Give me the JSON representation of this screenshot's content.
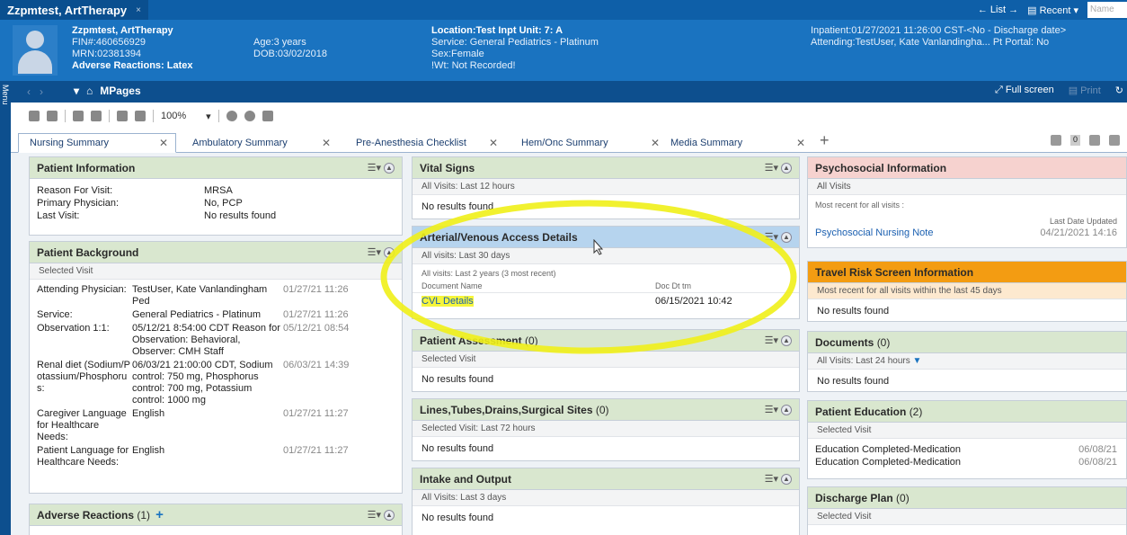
{
  "window_tab": {
    "title": "Zzpmtest, ArtTherapy",
    "close": "×"
  },
  "top_right": {
    "list": "List",
    "recent": "Recent",
    "name_placeholder": "Name"
  },
  "banner": {
    "patient_name": "Zzpmtest, ArtTherapy",
    "fin": "FIN#:460656929",
    "mrn": "MRN:02381394",
    "adverse": "Adverse Reactions: Latex",
    "age": "Age:3 years",
    "dob": "DOB:03/02/2018",
    "location": "Location:Test Inpt Unit: 7: A",
    "service": "Service: General Pediatrics - Platinum",
    "sex": "Sex:Female",
    "wt": "!Wt: Not Recorded!",
    "inpatient": "Inpatient:01/27/2021 11:26:00 CST-<No - Discharge date>",
    "attending": "Attending:TestUser, Kate Vanlandingha...  Pt Portal: No"
  },
  "nav": {
    "menu": "Menu",
    "title": "MPages",
    "fullscreen": "Full screen",
    "print": "Print"
  },
  "toolbar": {
    "zoom": "100%"
  },
  "tabs": [
    {
      "label": "Nursing Summary"
    },
    {
      "label": "Ambulatory Summary"
    },
    {
      "label": "Pre-Anesthesia Checklist"
    },
    {
      "label": "Hem/Onc Summary"
    },
    {
      "label": "Media Summary"
    }
  ],
  "tabs_extra": {
    "count_badge": "0"
  },
  "patient_info": {
    "title": "Patient Information",
    "rows": [
      {
        "label": "Reason For Visit:",
        "value": "MRSA"
      },
      {
        "label": "Primary Physician:",
        "value": "No, PCP"
      },
      {
        "label": "Last Visit:",
        "value": "No results found"
      }
    ]
  },
  "patient_background": {
    "title": "Patient Background",
    "sub": "Selected Visit",
    "rows": [
      {
        "label": "Attending Physician:",
        "value": "TestUser, Kate Vanlandingham Ped",
        "date": "01/27/21 11:26"
      },
      {
        "label": "Service:",
        "value": "General Pediatrics - Platinum",
        "date": "01/27/21 11:26"
      },
      {
        "label": "Observation 1:1:",
        "value": "05/12/21 8:54:00 CDT Reason for Observation: Behavioral, Observer: CMH Staff",
        "date": "05/12/21 08:54"
      },
      {
        "label": "Renal diet (Sodium/Potassium/Phosphorus:",
        "value": "06/03/21 21:00:00 CDT, Sodium control: 750 mg, Phosphorus control: 700 mg, Potassium control: 1000 mg",
        "date": "06/03/21 14:39"
      },
      {
        "label": "Caregiver Language for Healthcare Needs:",
        "value": "English",
        "date": "01/27/21 11:27"
      },
      {
        "label": "Patient Language for Healthcare Needs:",
        "value": "English",
        "date": "01/27/21 11:27"
      }
    ]
  },
  "adverse_reactions": {
    "title": "Adverse Reactions",
    "count": "(1)"
  },
  "vital_signs": {
    "title": "Vital Signs",
    "sub": "All Visits: Last 12 hours",
    "empty": "No results found"
  },
  "access_details": {
    "title": "Arterial/Venous Access Details",
    "sub": "All visits: Last 30 days",
    "sub2": "All visits: Last 2 years (3 most recent)",
    "col_doc": "Document Name",
    "col_dt": "Doc Dt tm",
    "doc_name": "CVL Details",
    "doc_dt": "06/15/2021 10:42"
  },
  "patient_assessment": {
    "title": "Patient Assessment",
    "count": "(0)",
    "sub": "Selected Visit",
    "empty": "No results found"
  },
  "lines_tubes": {
    "title": "Lines,Tubes,Drains,Surgical Sites",
    "count": "(0)",
    "sub": "Selected Visit: Last 72 hours",
    "empty": "No results found"
  },
  "intake_output": {
    "title": "Intake and Output",
    "sub": "All Visits: Last 3 days",
    "empty": "No results found"
  },
  "psychosocial": {
    "title": "Psychosocial Information",
    "sub": "All Visits",
    "note": "Most recent for all visits :",
    "col_date": "Last Date Updated",
    "item": "Psychosocial Nursing Note",
    "item_date": "04/21/2021 14:16"
  },
  "travel_risk": {
    "title": "Travel Risk Screen Information",
    "sub": "Most recent for all visits within the last 45 days",
    "empty": "No results found"
  },
  "documents": {
    "title": "Documents",
    "count": "(0)",
    "sub": "All Visits: Last 24 hours",
    "empty": "No results found"
  },
  "patient_education": {
    "title": "Patient Education",
    "count": "(2)",
    "sub": "Selected Visit",
    "items": [
      {
        "label": "Education Completed-Medication",
        "date": "06/08/21"
      },
      {
        "label": "Education Completed-Medication",
        "date": "06/08/21"
      }
    ]
  },
  "discharge_plan": {
    "title": "Discharge Plan",
    "count": "(0)",
    "sub": "Selected Visit"
  },
  "colors": {
    "highlight": "#f5f53b",
    "brand": "#1a73c0"
  }
}
